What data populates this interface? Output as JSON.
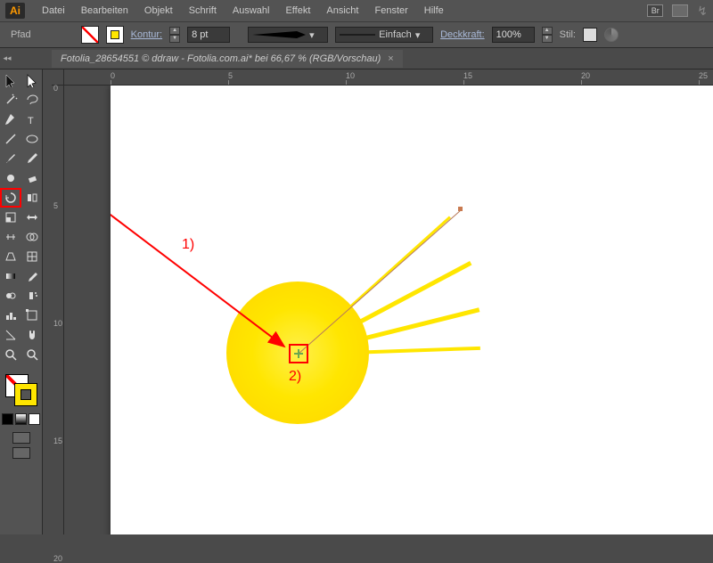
{
  "menu": {
    "items": [
      "Datei",
      "Bearbeiten",
      "Objekt",
      "Schrift",
      "Auswahl",
      "Effekt",
      "Ansicht",
      "Fenster",
      "Hilfe"
    ]
  },
  "app_logo": "Ai",
  "control": {
    "type_label": "Pfad",
    "kontur_label": "Kontur:",
    "stroke_weight": "8 pt",
    "profile_label": "Einfach",
    "opacity_label": "Deckkraft:",
    "opacity_value": "100%",
    "style_label": "Stil:"
  },
  "doc_tab": "Fotolia_28654551 © ddraw - Fotolia.com.ai* bei 66,67 % (RGB/Vorschau)",
  "ruler_h": [
    "0",
    "5",
    "10",
    "15",
    "20",
    "25"
  ],
  "ruler_v": [
    "0",
    "5",
    "10",
    "15",
    "20"
  ],
  "annotations": {
    "a1": "1)",
    "a2": "2)"
  },
  "tools": [
    [
      "selection",
      "direct-selection"
    ],
    [
      "magic-wand",
      "lasso"
    ],
    [
      "pen",
      "type"
    ],
    [
      "line",
      "ellipse"
    ],
    [
      "paintbrush",
      "pencil"
    ],
    [
      "blob",
      "eraser"
    ],
    [
      "rotate",
      "reflect"
    ],
    [
      "scale",
      "free-transform"
    ],
    [
      "width",
      "shape-builder"
    ],
    [
      "perspective",
      "mesh"
    ],
    [
      "gradient",
      "eyedropper"
    ],
    [
      "blend",
      "symbol-sprayer"
    ],
    [
      "column-graph",
      "artboard"
    ],
    [
      "slice",
      "hand"
    ],
    [
      "zoom",
      "zoom2"
    ]
  ],
  "colors": {
    "sun": "#ffe600",
    "accent": "#ff9a00"
  }
}
